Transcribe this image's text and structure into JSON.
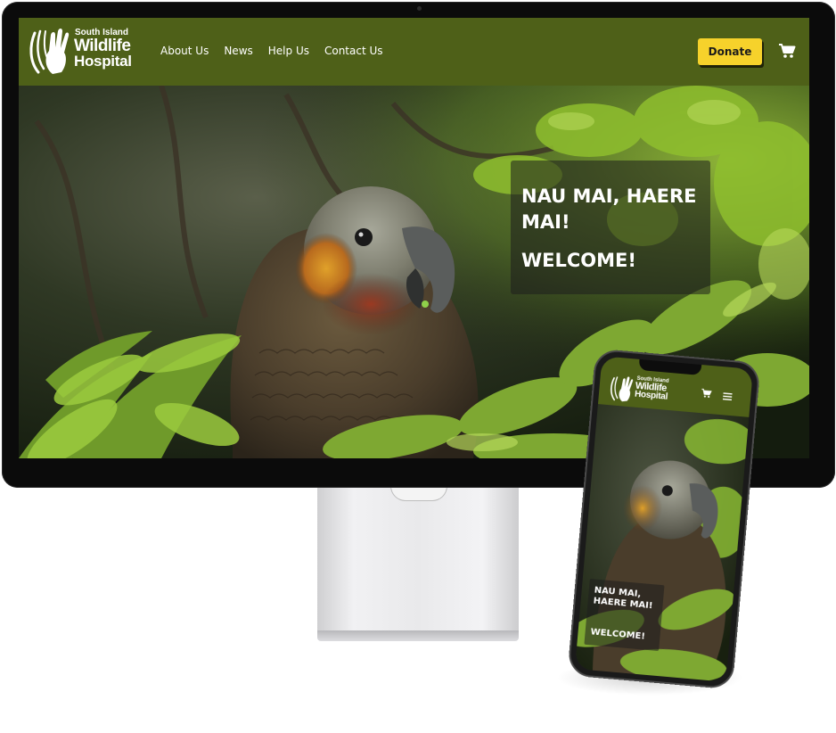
{
  "brand": {
    "name_line1": "South Island",
    "name_line2": "Wildlife",
    "name_line3": "Hospital",
    "logo_icon": "hand-bird-icon"
  },
  "desktop": {
    "nav": {
      "items": [
        {
          "label": "About Us"
        },
        {
          "label": "News"
        },
        {
          "label": "Help Us"
        },
        {
          "label": "Contact Us"
        }
      ],
      "donate_label": "Donate",
      "cart_icon": "cart-icon"
    },
    "hero": {
      "heading": "NAU MAI, HAERE MAI!",
      "subheading": "WELCOME!"
    }
  },
  "mobile": {
    "nav": {
      "cart_icon": "cart-icon",
      "menu_icon": "hamburger-menu-icon"
    },
    "hero": {
      "heading": "NAU MAI, HAERE MAI!",
      "subheading": "WELCOME!"
    }
  },
  "colors": {
    "nav_green": "#4e6018",
    "donate_yellow": "#f6d22b",
    "text_white": "#ffffff"
  }
}
